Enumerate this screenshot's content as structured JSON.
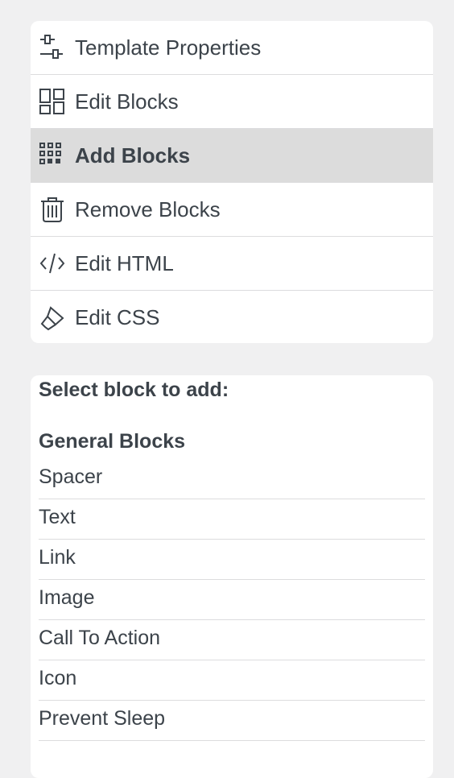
{
  "menu": {
    "items": [
      {
        "label": "Template Properties",
        "icon": "sliders-icon",
        "active": false
      },
      {
        "label": "Edit Blocks",
        "icon": "layout-icon",
        "active": false
      },
      {
        "label": "Add Blocks",
        "icon": "grid-dots-icon",
        "active": true
      },
      {
        "label": "Remove Blocks",
        "icon": "trash-icon",
        "active": false
      },
      {
        "label": "Edit HTML",
        "icon": "code-icon",
        "active": false
      },
      {
        "label": "Edit CSS",
        "icon": "paint-brush-icon",
        "active": false
      }
    ]
  },
  "blocks": {
    "title": "Select block to add:",
    "section_title": "General Blocks",
    "items": [
      "Spacer",
      "Text",
      "Link",
      "Image",
      "Call To Action",
      "Icon",
      "Prevent Sleep"
    ]
  },
  "colors": {
    "background": "#f0f0f1",
    "card": "#ffffff",
    "active_item": "#dcdcdc",
    "divider": "#dcdcde",
    "text": "#3c434a"
  }
}
